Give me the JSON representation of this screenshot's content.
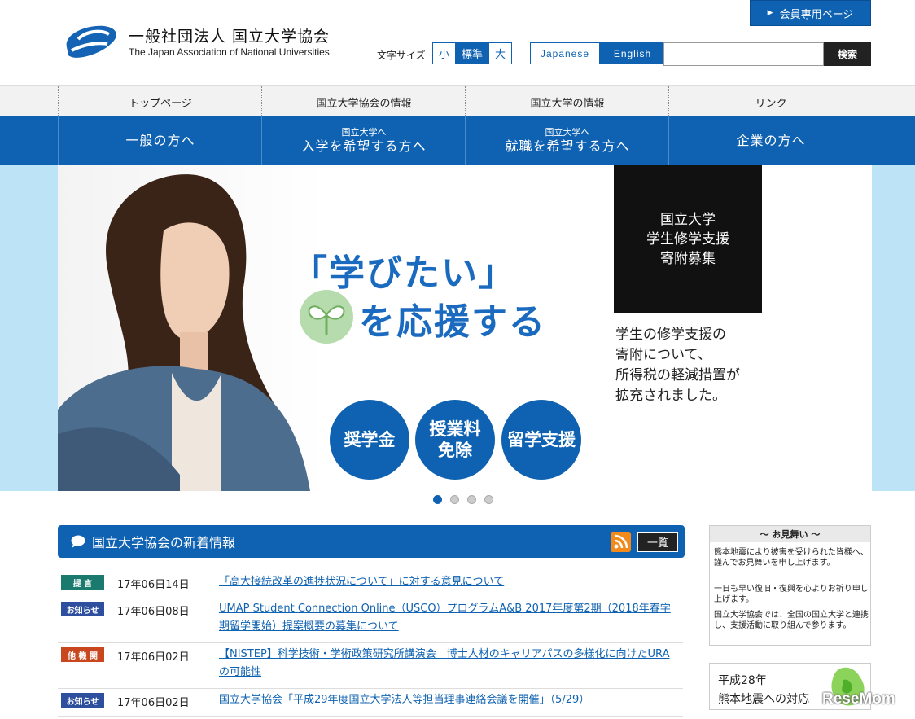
{
  "header": {
    "org_name_ja": "一般社団法人 国立大学協会",
    "org_name_en": "The Japan Association of National Universities",
    "member_button": "会員専用ページ",
    "font_size_label": "文字サイズ",
    "font_sizes": [
      "小",
      "標準",
      "大"
    ],
    "lang_ja": "Japanese",
    "lang_en": "English",
    "search_button": "検索",
    "accent_color": "#0f62b1"
  },
  "top_nav": [
    "トップページ",
    "国立大学協会の情報",
    "国立大学の情報",
    "リンク"
  ],
  "blue_nav": [
    {
      "small": "",
      "large": "一般の方へ"
    },
    {
      "small": "国立大学へ",
      "large": "入学を希望する方へ"
    },
    {
      "small": "国立大学へ",
      "large": "就職を希望する方へ"
    },
    {
      "small": "",
      "large": "企業の方へ"
    }
  ],
  "hero": {
    "title_line1": "「学びたい」",
    "title_line2": "を応援する",
    "circles": [
      {
        "line1": "奨学金",
        "line2": ""
      },
      {
        "line1": "授業料",
        "line2": "免除"
      },
      {
        "line1": "留学支援",
        "line2": ""
      }
    ],
    "donation_box": [
      "国立大学",
      "学生修学支援",
      "寄附募集"
    ],
    "donation_text": [
      "学生の修学支援の",
      "寄附について、",
      "所得税の軽減措置が",
      "拡充されました。"
    ]
  },
  "news": {
    "heading": "国立大学協会の新着情報",
    "list_button": "一覧",
    "items": [
      {
        "badge": "提 言",
        "badge_color": "#1a7a6e",
        "date": "17年06日14日",
        "title": "「高大接続改革の進捗状況について」に対する意見について"
      },
      {
        "badge": "お知らせ",
        "badge_color": "#2d4f9e",
        "date": "17年06日08日",
        "title": "UMAP Student Connection Online（USCO）プログラムA&B 2017年度第2期（2018年春学期留学開始）提案概要の募集について"
      },
      {
        "badge": "他 機 関",
        "badge_color": "#c9471e",
        "date": "17年06日02日",
        "title": "【NISTEP】科学技術・学術政策研究所講演会　博士人材のキャリアパスの多様化に向けたURAの可能性"
      },
      {
        "badge": "お知らせ",
        "badge_color": "#2d4f9e",
        "date": "17年06日02日",
        "title": "国立大学協会「平成29年度国立大学法人等担当理事連絡会議を開催」（5/29）"
      }
    ]
  },
  "sidebar": {
    "omimai_title": "～ お見舞い ～",
    "omimai_paragraphs": [
      "熊本地震により被害を受けられた皆様へ、謹んでお見舞いを申し上げます。",
      "一日も早い復旧・復興を心よりお祈り申し上げます。",
      "国立大学協会では、全国の国立大学と連携し、支援活動に取り組んで参ります。"
    ],
    "kumamoto_line1": "平成28年",
    "kumamoto_line2": "熊本地震への対応"
  },
  "watermark": "ReseMom"
}
